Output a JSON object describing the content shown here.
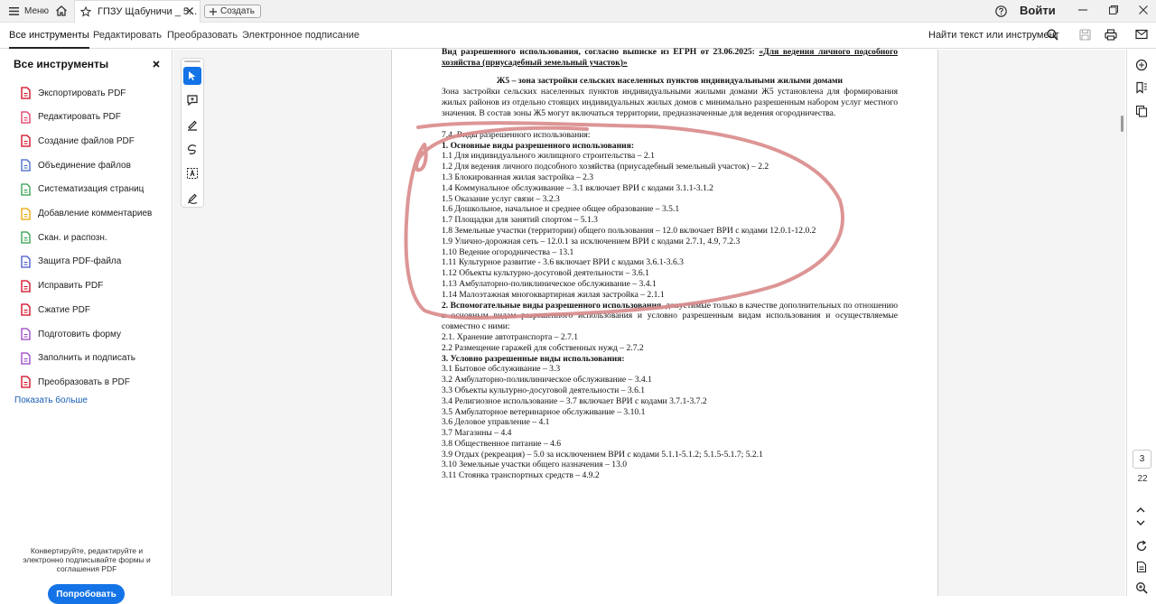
{
  "titlebar": {
    "menu_label": "Меню",
    "tab_title": "ГПЗУ Щабуничи _ 5...",
    "create_label": "Создать",
    "signin_label": "Войти"
  },
  "menubar": {
    "tabs": [
      "Все инструменты",
      "Редактировать",
      "Преобразовать",
      "Электронное подписание"
    ],
    "find_label": "Найти текст или инструмент"
  },
  "sidebar": {
    "title": "Все инструменты",
    "items": [
      {
        "label": "Экспортировать PDF",
        "icon": "export-pdf-icon",
        "color": "#d0021b"
      },
      {
        "label": "Редактировать PDF",
        "icon": "edit-pdf-icon",
        "color": "#e0335f"
      },
      {
        "label": "Создание файлов PDF",
        "icon": "create-pdf-icon",
        "color": "#d0021b"
      },
      {
        "label": "Объединение файлов",
        "icon": "combine-files-icon",
        "color": "#3d63c9"
      },
      {
        "label": "Систематизация страниц",
        "icon": "organize-pages-icon",
        "color": "#2d9d48"
      },
      {
        "label": "Добавление комментариев",
        "icon": "comment-icon",
        "color": "#e8a400"
      },
      {
        "label": "Скан. и распозн.",
        "icon": "scan-icon",
        "color": "#2d9d48"
      },
      {
        "label": "Защита PDF-файла",
        "icon": "protect-icon",
        "color": "#4456c7"
      },
      {
        "label": "Исправить PDF",
        "icon": "redact-icon",
        "color": "#d0021b"
      },
      {
        "label": "Сжатие PDF",
        "icon": "compress-icon",
        "color": "#d0021b"
      },
      {
        "label": "Подготовить форму",
        "icon": "prepare-form-icon",
        "color": "#9b3fc2"
      },
      {
        "label": "Заполнить и подписать",
        "icon": "fill-sign-icon",
        "color": "#9b3fc2"
      },
      {
        "label": "Преобразовать в PDF",
        "icon": "convert-pdf-icon",
        "color": "#d0021b"
      }
    ],
    "show_more": "Показать больше",
    "promo_text": "Конвертируйте, редактируйте и электронно подписывайте формы и соглашения PDF",
    "try_label": "Попробовать"
  },
  "document": {
    "intro": "Вид разрешенного использования, согласно выписке из ЕГРН от 23.06.2025:",
    "intro_link": "«Для ведения личного подсобного хозяйства (приусадебный земельный участок)»",
    "zone_heading": "Ж5 – зона застройки сельских населенных пунктов индивидуальными жилыми домами",
    "zone_text": "Зона застройки сельских населенных пунктов индивидуальными жилыми домами Ж5 установлена для формирования жилых районов из отдельно стоящих индивидуальных жилых домов с минимально разрешенным набором услуг местного значения. В состав зоны Ж5 могут включаться территории, предназначенные для ведения огородничества.",
    "section_title": "7.4. Виды разрешенного использования:",
    "main_heading": "1. Основные виды разрешенного использования:",
    "main_items": [
      "1.1 Для индивидуального жилищного строительства – 2.1",
      "1.2 Для ведения личного подсобного хозяйства (приусадебный земельный участок) – 2.2",
      "1.3 Блокированная жилая застройка – 2.3",
      "1.4 Коммунальное обслуживание – 3.1 включает ВРИ с кодами 3.1.1-3.1.2",
      "1.5 Оказание услуг связи – 3.2.3",
      "1.6 Дошкольное, начальное и среднее общее образование – 3.5.1",
      "1.7 Площадки для занятий спортом – 5.1.3",
      "1.8 Земельные участки (территории) общего пользования – 12.0 включает ВРИ с кодами 12.0.1-12.0.2",
      "1.9 Улично-дорожная сеть – 12.0.1 за исключением ВРИ с кодами 2.7.1, 4.9, 7.2.3",
      "1.10 Ведение огородничества – 13.1",
      "1.11 Культурное развитие - 3.6 включает ВРИ с кодами 3.6.1-3.6.3",
      "1.12 Объекты культурно-досуговой деятельности – 3.6.1",
      "1.13 Амбулаторно-поликлиническое обслуживание – 3.4.1",
      "1.14 Малоэтажная многоквартирная жилая застройка – 2.1.1"
    ],
    "aux_heading": "2. Вспомогательные виды разрешенного использования",
    "aux_text": ", допустимые только в качестве дополнительных по отношению к основным видам разрешенного использования и условно разрешенным видам использования и осуществляемые совместно с ними:",
    "aux_items": [
      "2.1. Хранение автотранспорта – 2.7.1",
      "2.2 Размещение гаражей для собственных нужд – 2.7.2"
    ],
    "cond_heading": "3. Условно разрешенные виды использования:",
    "cond_items": [
      "3.1 Бытовое обслуживание – 3.3",
      "3.2 Амбулаторно-поликлиническое обслуживание – 3.4.1",
      "3.3 Объекты культурно-досуговой деятельности – 3.6.1",
      "3.4 Религиозное использование – 3.7 включает ВРИ с кодами 3.7.1-3.7.2",
      "3.5 Амбулаторное ветеринарное обслуживание – 3.10.1",
      "3.6 Деловое управление – 4.1",
      "3.7 Магазины – 4.4",
      "3.8 Общественное питание – 4.6",
      "3.9 Отдых (рекреация) – 5.0 за исключением ВРИ с кодами 5.1.1-5.1.2; 5.1.5-5.1.7; 5.2.1",
      "3.10 Земельные участки общего назначения – 13.0",
      "3.11 Стоянка транспортных средств – 4.9.2"
    ]
  },
  "navigation": {
    "current_page": "3",
    "total_pages": "22"
  },
  "colors": {
    "accent": "#1473e6",
    "pen_mark": "#d98a8a"
  }
}
